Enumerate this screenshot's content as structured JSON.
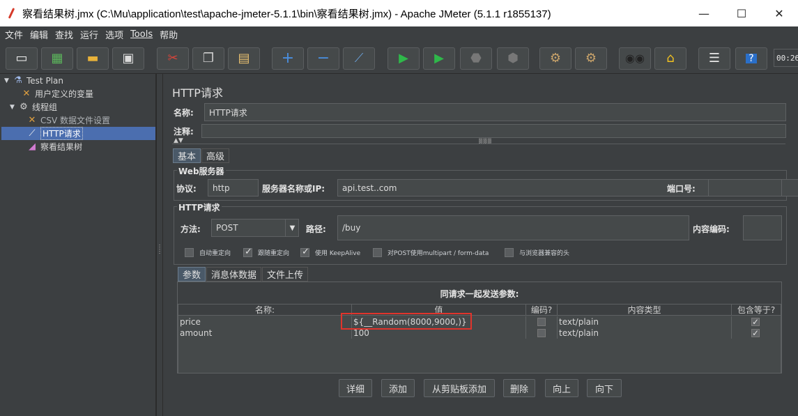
{
  "window": {
    "title": "察看结果树.jmx (C:\\Mu\\application\\test\\apache-jmeter-5.1.1\\bin\\察看结果树.jmx) - Apache JMeter (5.1.1 r1855137)",
    "minimize": "—",
    "maximize": "☐",
    "close": "✕"
  },
  "menu": [
    "文件",
    "编辑",
    "查找",
    "运行",
    "选项",
    "Tools",
    "帮助"
  ],
  "toolbar": {
    "icons": [
      "new-icon",
      "templates-icon",
      "open-icon",
      "save-icon",
      "cut-icon",
      "copy-icon",
      "paste-icon",
      "expand-icon",
      "collapse-icon",
      "toggle-icon",
      "start-icon",
      "start-no-pause-icon",
      "stop-icon",
      "shutdown-icon",
      "clear-icon",
      "clear-all-icon",
      "search-icon",
      "reset-search-icon",
      "function-helper-icon",
      "help-icon"
    ],
    "timer": "00:26"
  },
  "tree": {
    "items": [
      {
        "label": "Test Plan",
        "icon": "flask-icon"
      },
      {
        "label": "用户定义的变量",
        "icon": "wrench-icon"
      },
      {
        "label": "线程组",
        "icon": "gear-icon"
      },
      {
        "label": "CSV 数据文件设置",
        "icon": "wrench-icon"
      },
      {
        "label": "HTTP请求",
        "icon": "pipette-icon"
      },
      {
        "label": "察看结果树",
        "icon": "chart-icon"
      }
    ]
  },
  "panel": {
    "title": "HTTP请求",
    "name_label": "名称:",
    "name_value": "HTTP请求",
    "comment_label": "注释:",
    "comment_value": ""
  },
  "tabs": [
    "基本",
    "高级"
  ],
  "web_server": {
    "group_title": "Web服务器",
    "protocol_label": "协议:",
    "protocol_value": "http",
    "server_label": "服务器名称或IP:",
    "server_value": "api.test..com",
    "port_label": "端口号:",
    "port_value": ""
  },
  "http_request": {
    "group_title": "HTTP请求",
    "method_label": "方法:",
    "method_value": "POST",
    "path_label": "路径:",
    "path_value": "/buy",
    "encoding_label": "内容编码:",
    "encoding_value": ""
  },
  "options": [
    {
      "label": "自动重定向",
      "checked": false
    },
    {
      "label": "跟随重定向",
      "checked": true
    },
    {
      "label": "使用 KeepAlive",
      "checked": true
    },
    {
      "label": "对POST使用multipart / form-data",
      "checked": false
    },
    {
      "label": "与浏览器兼容的头",
      "checked": false
    }
  ],
  "subtabs": [
    "参数",
    "消息体数据",
    "文件上传"
  ],
  "params": {
    "caption": "同请求一起发送参数:",
    "columns": [
      "名称:",
      "值",
      "编码?",
      "内容类型",
      "包含等于?"
    ],
    "rows": [
      {
        "name": "price",
        "value": "${__Random(8000,9000,)}",
        "encode": false,
        "content_type": "text/plain",
        "include_equals": true
      },
      {
        "name": "amount",
        "value": "100",
        "encode": false,
        "content_type": "text/plain",
        "include_equals": true
      }
    ]
  },
  "buttons": [
    "详细",
    "添加",
    "从剪贴板添加",
    "删除",
    "向上",
    "向下"
  ],
  "colors": {
    "highlight": "#e0342c",
    "selection": "#4b6eaf",
    "background": "#3c3f41"
  }
}
